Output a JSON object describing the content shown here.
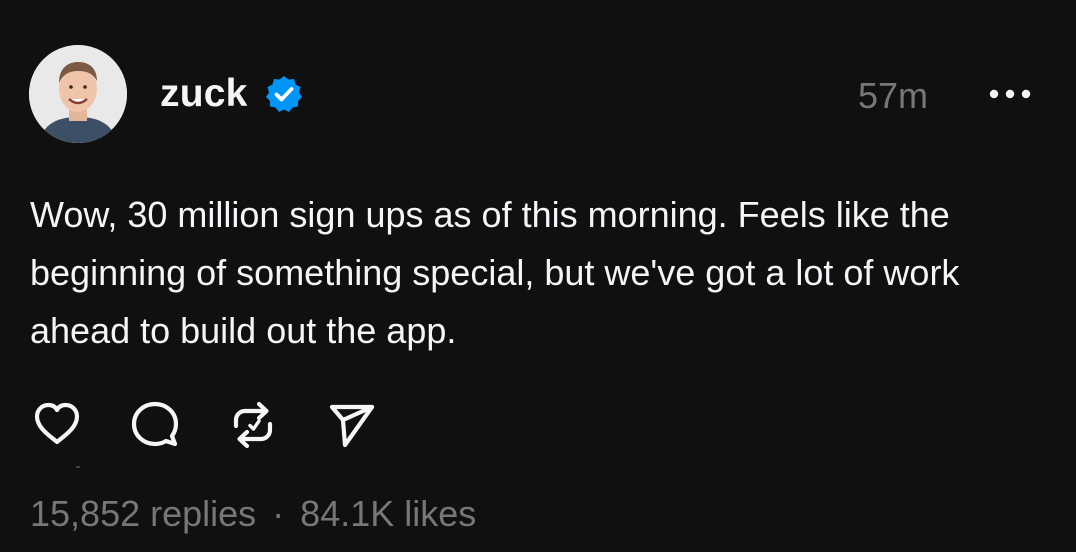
{
  "post": {
    "author": {
      "username": "zuck",
      "verified": true
    },
    "timestamp": "57m",
    "text": "Wow, 30 million sign ups as of this morning. Feels like the beginning of something special, but we've got a lot of work ahead to build out the app.",
    "stats": {
      "replies": "15,852 replies",
      "separator": "·",
      "likes": "84.1K likes"
    }
  },
  "icons": {
    "verified": "verified-badge-icon",
    "more": "more-options-icon",
    "like": "heart-icon",
    "reply": "comment-icon",
    "repost": "repost-icon",
    "share": "send-icon"
  },
  "colors": {
    "background": "#101010",
    "text": "#f3f5f7",
    "muted": "#777777",
    "verified": "#0095f6"
  }
}
